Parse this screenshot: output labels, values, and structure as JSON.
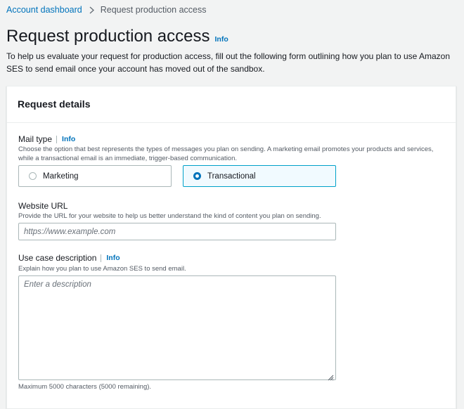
{
  "breadcrumb": {
    "parent": "Account dashboard",
    "current": "Request production access"
  },
  "header": {
    "title": "Request production access",
    "info": "Info",
    "description": "To help us evaluate your request for production access, fill out the following form outlining how you plan to use Amazon SES to send email once your account has moved out of the sandbox."
  },
  "panel": {
    "title": "Request details"
  },
  "mail_type": {
    "label": "Mail type",
    "info": "Info",
    "description": "Choose the option that best represents the types of messages you plan on sending. A marketing email promotes your products and services, while a transactional email is an immediate, trigger-based communication.",
    "options": [
      {
        "label": "Marketing",
        "selected": false
      },
      {
        "label": "Transactional",
        "selected": true
      }
    ]
  },
  "website_url": {
    "label": "Website URL",
    "description": "Provide the URL for your website to help us better understand the kind of content you plan on sending.",
    "value": "",
    "placeholder": "https://www.example.com"
  },
  "use_case": {
    "label": "Use case description",
    "info": "Info",
    "description": "Explain how you plan to use Amazon SES to send email.",
    "value": "",
    "placeholder": "Enter a description",
    "constraint": "Maximum 5000 characters  (5000 remaining)."
  },
  "colors": {
    "link": "#0073bb",
    "selected_border": "#00a1c9",
    "selected_bg": "#f1faff",
    "background": "#f2f3f3"
  }
}
